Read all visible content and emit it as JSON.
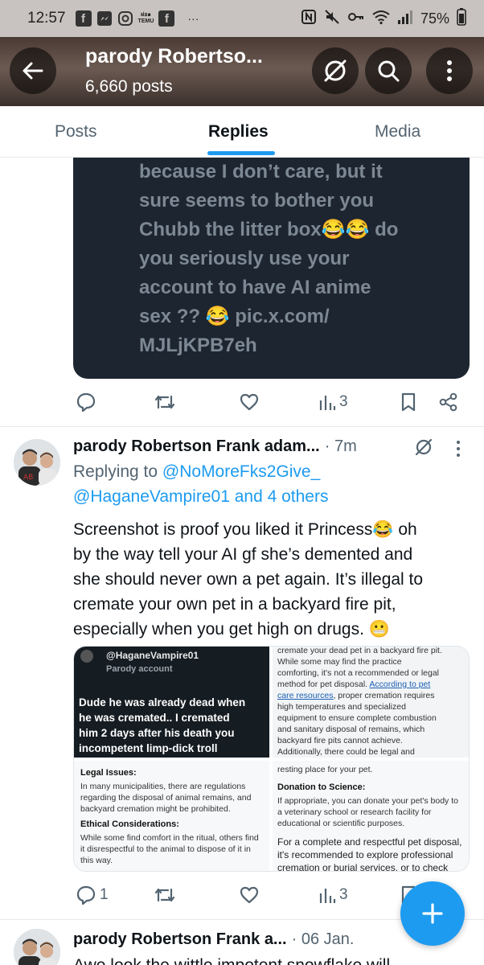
{
  "status_bar": {
    "time": "12:57",
    "app_icons": [
      "facebook-icon",
      "messenger-icon",
      "instagram-icon",
      "temu-icon",
      "facebook-icon"
    ],
    "temu_label_top": "ฝอ๑",
    "temu_label_bottom": "TEMU",
    "overflow": "···",
    "battery": "75%"
  },
  "header": {
    "title": "parody Robertso...",
    "posts_count": "6,660 posts"
  },
  "tabs": [
    {
      "label": "Posts"
    },
    {
      "label": "Replies",
      "active": true
    },
    {
      "label": "Media"
    }
  ],
  "first_post": {
    "image_text_lines": [
      "because I don’t care, but it",
      "sure seems to bother you",
      "Chubb the litter box😂😂 do",
      "you seriously use your",
      "account to have AI anime",
      "sex ?? 😂 pic.x.com/",
      "MJLjKPB7eh"
    ],
    "views": "3"
  },
  "tweet": {
    "author": "parody Robertson Frank adam...",
    "time": "· 7m",
    "replying_prefix": "Replying to",
    "replying_to_1": "@NoMoreFks2Give_",
    "replying_to_2": "@HaganeVampire01 and 4 others",
    "body_lines": [
      "Screenshot is proof you liked it Princess😂 oh",
      "by the way tell your AI gf she’s demented and",
      "she should never own a pet again. It’s illegal to",
      "cremate your own pet in a backyard fire pit,",
      "especially when you get high on drugs. 😬"
    ],
    "media": {
      "top_left": {
        "handle": "@HaganeVampire01",
        "badge": "Parody account",
        "text_lines": [
          "Dude he was already dead when",
          "he was cremated.. I cremated",
          "him 2 days after his death you",
          "incompetent limp-dick troll"
        ]
      },
      "top_right": {
        "lines": [
          "cremate your dead pet in a backyard fire pit.",
          "While some may find the practice",
          "comforting, it's not a recommended or legal",
          "method for pet disposal."
        ],
        "link1": "According to pet",
        "link2": "care resources",
        "lines2": [
          ", proper cremation requires",
          "high temperatures and specialized",
          "equipment to ensure complete combustion",
          "and sanitary disposal of remains, which",
          "backyard fire pits cannot achieve.",
          "Additionally, there could be legal and"
        ]
      },
      "bottom_left": {
        "heading1": "Legal Issues:",
        "para1": [
          "In many municipalities, there are regulations",
          "regarding the disposal of animal remains, and",
          "backyard cremation might be prohibited."
        ],
        "heading2": "Ethical Considerations:",
        "para2": [
          "While some find comfort in the ritual, others find",
          "it disrespectful to the animal to dispose of it in",
          "this way."
        ]
      },
      "bottom_right": {
        "top_line": "resting place for your pet.",
        "heading": "Donation to Science:",
        "para": [
          "If appropriate, you can donate your pet's body to",
          "a veterinary school or research facility for",
          "educational or scientific purposes."
        ],
        "closing": [
          "For a complete and respectful pet disposal,",
          "it's recommended to explore professional",
          "cremation or burial services, or to check"
        ]
      }
    },
    "replies": "1",
    "views": "3"
  },
  "next_tweet": {
    "author": "parody Robertson Frank a...",
    "time": "· 06 Jan.",
    "body_partial": "Awe look the wittle impotent snowflake will"
  },
  "colors": {
    "accent": "#1d9bf0",
    "text": "#0f1419",
    "secondary": "#536471"
  }
}
